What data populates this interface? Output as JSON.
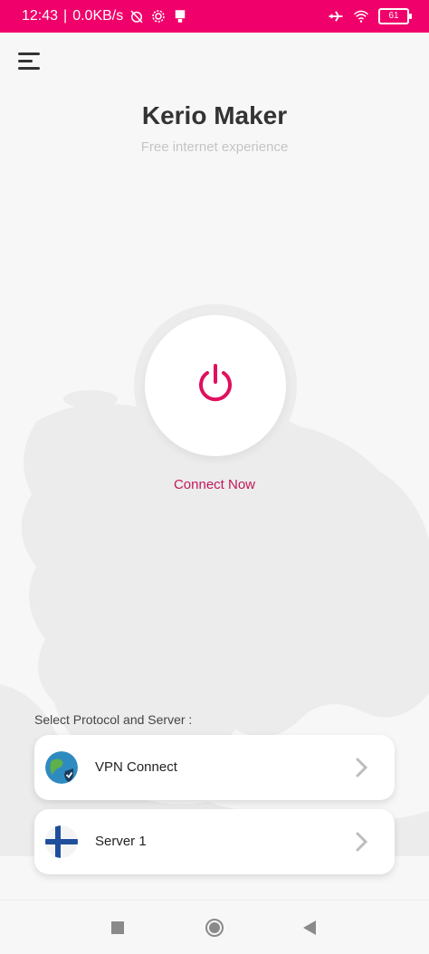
{
  "status_bar": {
    "time": "12:43",
    "network_speed": "0.0KB/s",
    "battery_level": "61",
    "icons": [
      "muted-alarm-icon",
      "settings-icon",
      "notification-icon",
      "airplane-icon",
      "wifi-icon",
      "battery-icon"
    ]
  },
  "app": {
    "title": "Kerio Maker",
    "subtitle": "Free internet experience",
    "connect_label": "Connect Now",
    "accent_color": "#e0105e",
    "section_label": "Select Protocol and Server :",
    "protocol": {
      "label": "VPN Connect",
      "icon": "globe-shield-icon"
    },
    "server": {
      "label": "Server 1",
      "icon": "finland-flag-icon"
    }
  },
  "nav": {
    "buttons": [
      "recents-button",
      "home-button",
      "back-button"
    ]
  }
}
